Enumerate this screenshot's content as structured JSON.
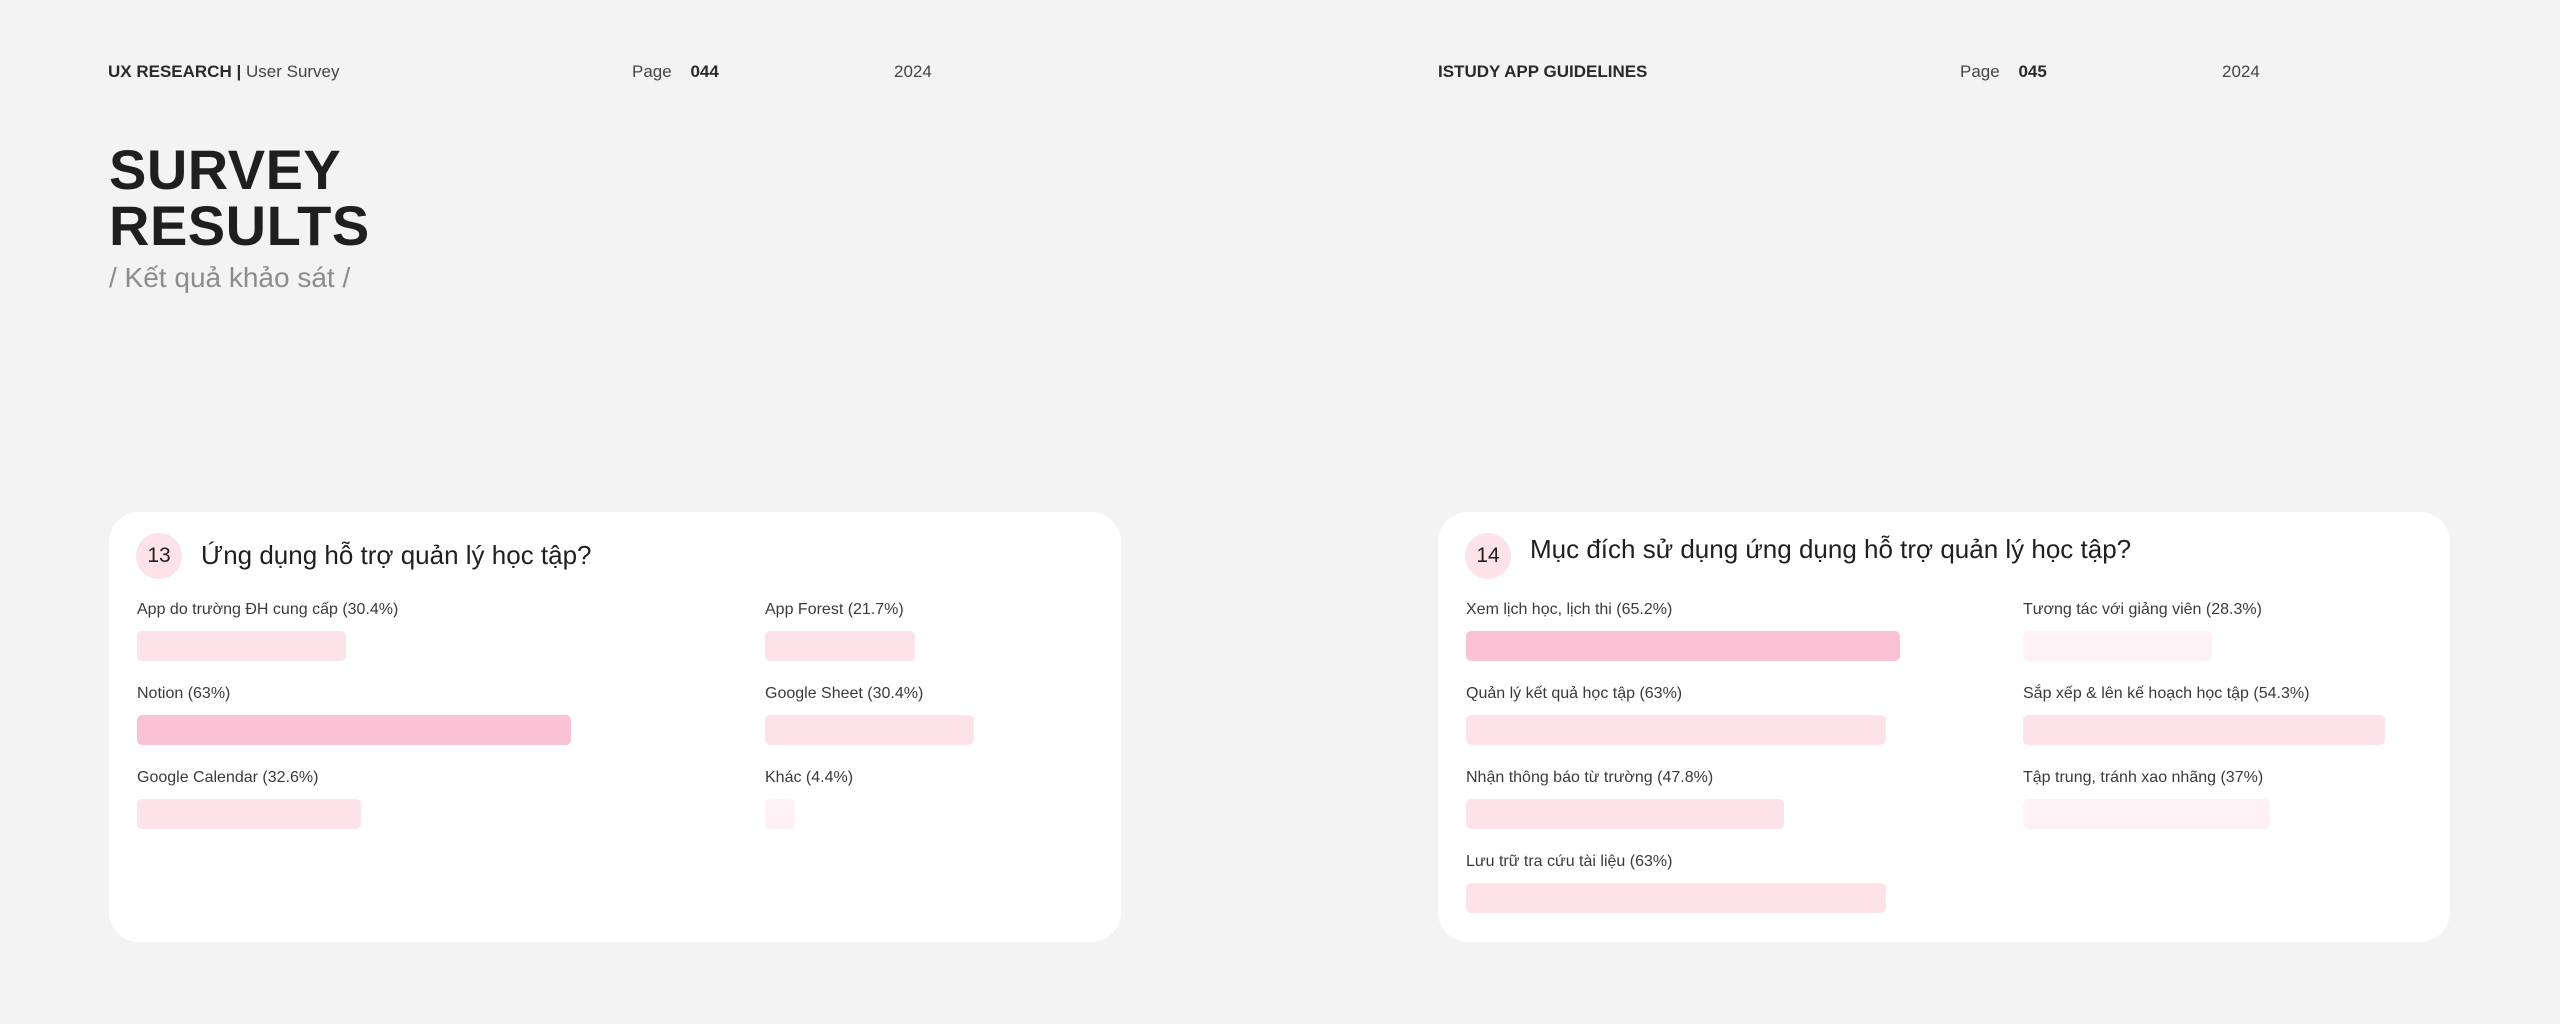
{
  "page_left": {
    "header": {
      "section": "UX RESEARCH",
      "separator": "|",
      "subsection": "User Survey",
      "page_label": "Page",
      "page_number": "044",
      "year": "2024"
    },
    "title_line1": "SURVEY",
    "title_line2": "RESULTS",
    "subtitle": "/ Kết quả khảo sát /",
    "question": {
      "number": "13",
      "text": "Ứng dụng hỗ trợ quản lý học tập?",
      "options": [
        {
          "label": "App do trường ĐH cung cấp (30.4%)",
          "percent": 30.4
        },
        {
          "label": "Notion (63%)",
          "percent": 63
        },
        {
          "label": "Google Calendar (32.6%)",
          "percent": 32.6
        },
        {
          "label": "App Forest (21.7%)",
          "percent": 21.7
        },
        {
          "label": "Google Sheet (30.4%)",
          "percent": 30.4
        },
        {
          "label": "Khác (4.4%)",
          "percent": 4.4
        }
      ]
    }
  },
  "page_right": {
    "header": {
      "section": "ISTUDY APP GUIDELINES",
      "page_label": "Page",
      "page_number": "045",
      "year": "2024"
    },
    "question": {
      "number": "14",
      "text": "Mục đích sử dụng ứng dụng hỗ trợ quản lý học tập?",
      "options": [
        {
          "label": "Xem lịch học, lịch thi (65.2%)",
          "percent": 65.2
        },
        {
          "label": "Quản lý kết quả học tập (63%)",
          "percent": 63
        },
        {
          "label": "Nhận thông báo từ trường (47.8%)",
          "percent": 47.8
        },
        {
          "label": "Lưu trữ tra cứu tài liệu (63%)",
          "percent": 63
        },
        {
          "label": "Tương tác với giảng viên (28.3%)",
          "percent": 28.3
        },
        {
          "label": "Sắp xếp & lên kế hoạch học tập (54.3%)",
          "percent": 54.3
        },
        {
          "label": "Tập trung, tránh xao nhãng (37%)",
          "percent": 37
        }
      ]
    }
  },
  "colors": {
    "background": "#f3f3f3",
    "card": "#ffffff",
    "badge": "#fde2ea",
    "bar_strong": "#fac2d4",
    "bar_medium": "#fde2ea",
    "bar_light": "#fef1f5"
  }
}
